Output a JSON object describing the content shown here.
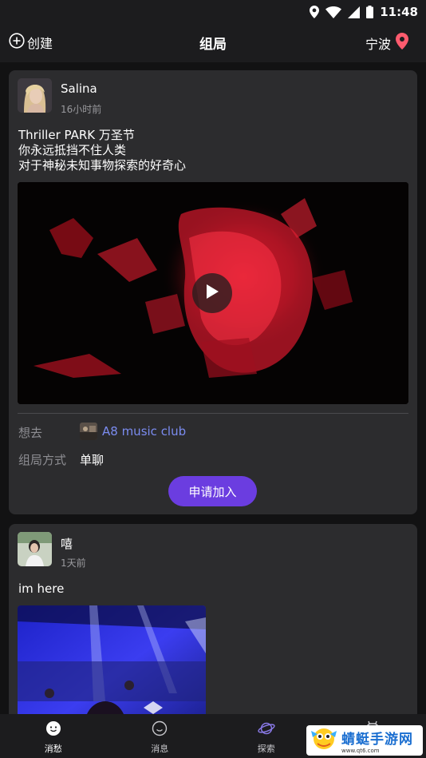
{
  "status_bar": {
    "time": "11:48",
    "icons": [
      "location-icon",
      "wifi-icon",
      "signal-icon",
      "battery-icon"
    ]
  },
  "header": {
    "create_label": "创建",
    "title": "组局",
    "city": "宁波"
  },
  "posts": [
    {
      "username": "Salina",
      "time_ago": "16小时前",
      "text_lines": [
        "Thriller PARK 万圣节",
        "你永远抵挡不住人类",
        "对于神秘未知事物探索的好奇心"
      ],
      "want_to_go_label": "想去",
      "venue_name": "A8 music club",
      "mode_label": "组局方式",
      "mode_value": "单聊",
      "join_label": "申请加入"
    },
    {
      "username": "嘻",
      "time_ago": "1天前",
      "text": "im here"
    }
  ],
  "tabs": [
    {
      "label": "消愁",
      "icon": "smile-icon",
      "active": true
    },
    {
      "label": "消息",
      "icon": "chat-icon",
      "active": false
    },
    {
      "label": "探索",
      "icon": "planet-icon",
      "active": false
    },
    {
      "label": "",
      "icon": "profile-icon",
      "active": false
    }
  ],
  "watermark": {
    "text": "蜻蜓手游网",
    "url": "www.qt6.com"
  },
  "colors": {
    "accent": "#6b3de0",
    "link": "#7b8cf0",
    "location_pin": "#ff5b6e"
  }
}
